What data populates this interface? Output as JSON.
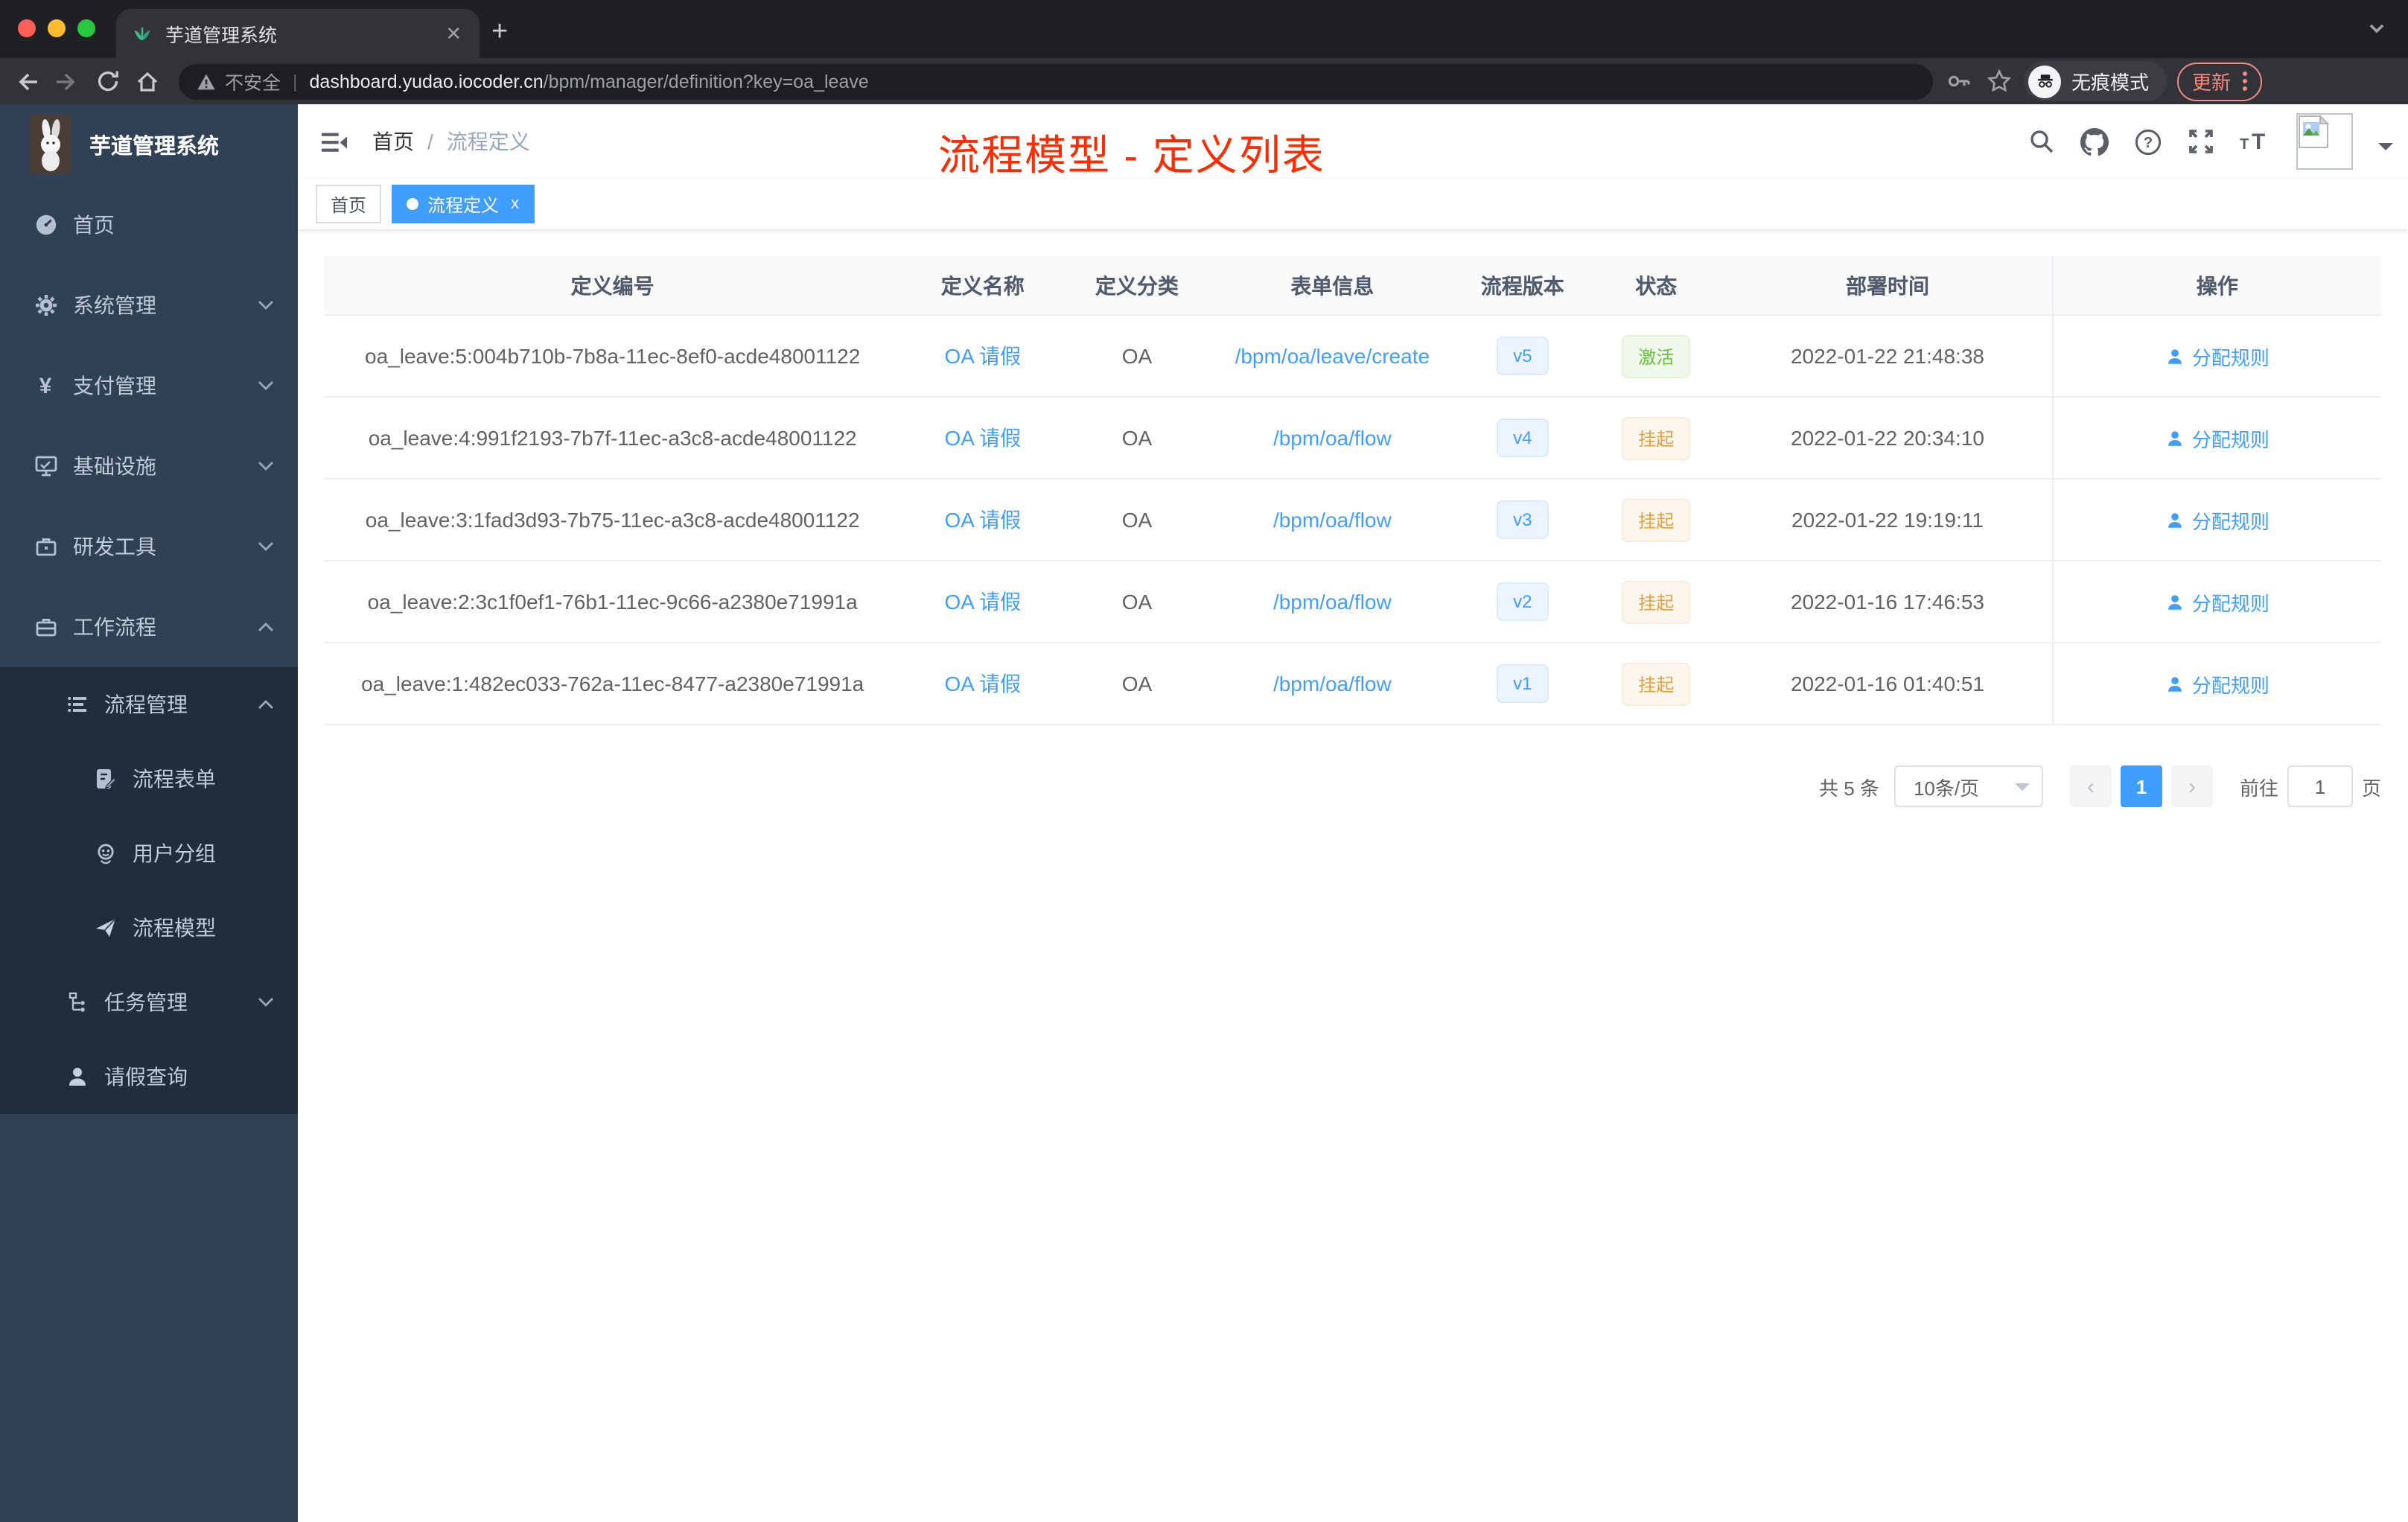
{
  "browser": {
    "tab_title": "芋道管理系统",
    "new_tab_label": "+",
    "toolbar": {
      "security_label": "不安全",
      "url_host": "dashboard.yudao.iocoder.cn",
      "url_path": "/bpm/manager/definition?key=oa_leave",
      "incognito_label": "无痕模式",
      "update_label": "更新"
    }
  },
  "app": {
    "brand": "芋道管理系统",
    "navbar": {
      "breadcrumb_home": "首页",
      "breadcrumb_separator": "/",
      "breadcrumb_current": "流程定义"
    },
    "annotation": {
      "text": "流程模型 - 定义列表",
      "color": "#fe2c00"
    },
    "tags": [
      {
        "label": "首页",
        "active": false
      },
      {
        "label": "流程定义",
        "active": true,
        "close": "x"
      }
    ],
    "sidebar": {
      "items": [
        {
          "label": "首页",
          "icon": "dashboard-icon"
        },
        {
          "label": "系统管理",
          "icon": "gear-icon"
        },
        {
          "label": "支付管理",
          "icon": "yen-icon"
        },
        {
          "label": "基础设施",
          "icon": "monitor-icon"
        },
        {
          "label": "研发工具",
          "icon": "toolbox-icon"
        },
        {
          "label": "工作流程",
          "icon": "briefcase-icon"
        },
        {
          "label": "流程管理",
          "icon": "list-icon"
        },
        {
          "label": "流程表单",
          "icon": "form-icon"
        },
        {
          "label": "用户分组",
          "icon": "user-group-icon"
        },
        {
          "label": "流程模型",
          "icon": "paper-plane-icon"
        },
        {
          "label": "任务管理",
          "icon": "tree-icon"
        },
        {
          "label": "请假查询",
          "icon": "person-icon"
        }
      ]
    },
    "table": {
      "columns": [
        "定义编号",
        "定义名称",
        "定义分类",
        "表单信息",
        "流程版本",
        "状态",
        "部署时间",
        "操作"
      ],
      "rows": [
        {
          "id": "oa_leave:5:004b710b-7b8a-11ec-8ef0-acde48001122",
          "name": "OA 请假",
          "category": "OA",
          "form": "/bpm/oa/leave/create",
          "version": "v5",
          "status": "激活",
          "status_type": "success",
          "deploy_time": "2022-01-22 21:48:38",
          "action": "分配规则"
        },
        {
          "id": "oa_leave:4:991f2193-7b7f-11ec-a3c8-acde48001122",
          "name": "OA 请假",
          "category": "OA",
          "form": "/bpm/oa/flow",
          "version": "v4",
          "status": "挂起",
          "status_type": "warning",
          "deploy_time": "2022-01-22 20:34:10",
          "action": "分配规则"
        },
        {
          "id": "oa_leave:3:1fad3d93-7b75-11ec-a3c8-acde48001122",
          "name": "OA 请假",
          "category": "OA",
          "form": "/bpm/oa/flow",
          "version": "v3",
          "status": "挂起",
          "status_type": "warning",
          "deploy_time": "2022-01-22 19:19:11",
          "action": "分配规则"
        },
        {
          "id": "oa_leave:2:3c1f0ef1-76b1-11ec-9c66-a2380e71991a",
          "name": "OA 请假",
          "category": "OA",
          "form": "/bpm/oa/flow",
          "version": "v2",
          "status": "挂起",
          "status_type": "warning",
          "deploy_time": "2022-01-16 17:46:53",
          "action": "分配规则"
        },
        {
          "id": "oa_leave:1:482ec033-762a-11ec-8477-a2380e71991a",
          "name": "OA 请假",
          "category": "OA",
          "form": "/bpm/oa/flow",
          "version": "v1",
          "status": "挂起",
          "status_type": "warning",
          "deploy_time": "2022-01-16 01:40:51",
          "action": "分配规则"
        }
      ]
    },
    "pagination": {
      "total": "共 5 条",
      "page_size": "10条/页",
      "current_page": "1",
      "goto_label": "前往",
      "goto_value": "1",
      "page_unit": "页"
    },
    "colors": {
      "primary": "#409eff",
      "success": "#67c23a",
      "warning": "#e6a23c",
      "annotation": "#fe2c00",
      "sidebar_bg": "#304156",
      "submenu_bg": "#1f2d3d"
    }
  }
}
